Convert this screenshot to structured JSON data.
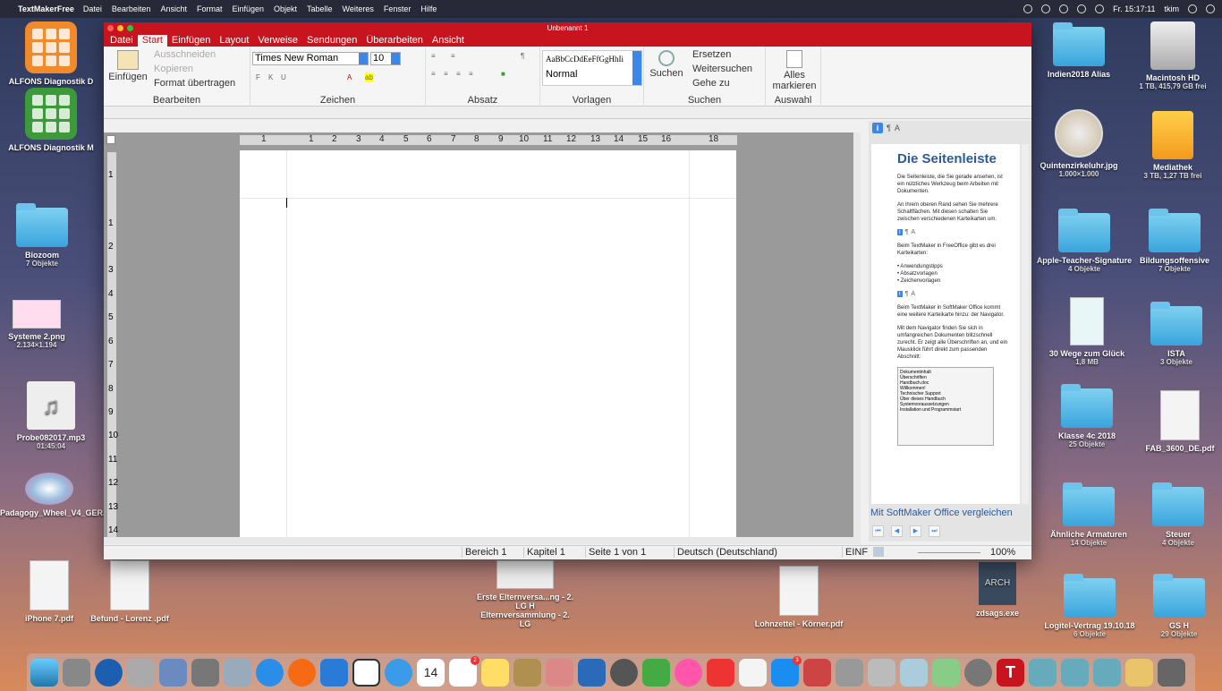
{
  "menubar": {
    "app": "TextMakerFree",
    "items": [
      "Datei",
      "Bearbeiten",
      "Ansicht",
      "Format",
      "Einfügen",
      "Objekt",
      "Tabelle",
      "Weiteres",
      "Fenster",
      "Hilfe"
    ],
    "clock": "Fr. 15:17:11",
    "user": "tkim"
  },
  "desktop": {
    "left": [
      {
        "name": "ALFONS Diagnostik D",
        "sub": ""
      },
      {
        "name": "ALFONS Diagnostik M",
        "sub": ""
      },
      {
        "name": "Biozoom",
        "sub": "7 Objekte"
      },
      {
        "name": "Systeme 2.png",
        "sub": "2.134×1.194"
      },
      {
        "name": "Probe082017.mp3",
        "sub": "01:45:04"
      },
      {
        "name": "Padagogy_Wheel_V4_GER.pdf",
        "sub": ""
      },
      {
        "name": "iPhone 7.pdf",
        "sub": ""
      },
      {
        "name": "Befund - Lorenz .pdf",
        "sub": ""
      }
    ],
    "right": [
      {
        "name": "Indien2018 Alias",
        "sub": ""
      },
      {
        "name": "Macintosh HD",
        "sub": "1 TB, 415,79 GB frei"
      },
      {
        "name": "Quintenzirkeluhr.jpg",
        "sub": "1.000×1.000"
      },
      {
        "name": "Mediathek",
        "sub": "3 TB, 1,27 TB frei"
      },
      {
        "name": "Apple-Teacher-Signature",
        "sub": "4 Objekte"
      },
      {
        "name": "Bildungsoffensive",
        "sub": "7 Objekte"
      },
      {
        "name": "30  Wege zum Glück",
        "sub": "1,8 MB"
      },
      {
        "name": "ISTA",
        "sub": "3 Objekte"
      },
      {
        "name": "Klasse 4c 2018",
        "sub": "25 Objekte"
      },
      {
        "name": "FAB_3600_DE.pdf",
        "sub": ""
      },
      {
        "name": "Ähnliche Armaturen",
        "sub": "14 Objekte"
      },
      {
        "name": "Steuer",
        "sub": "4 Objekte"
      },
      {
        "name": "zdsags.exe",
        "sub": ""
      },
      {
        "name": "Logitel-Vertrag 19.10.18",
        "sub": "6 Objekte"
      },
      {
        "name": "GS H",
        "sub": "29 Objekte"
      }
    ],
    "bottom": [
      {
        "name": "Erste Elternversa...ng - 2. LG H",
        "sub": ""
      },
      {
        "name": "Elternversammlung - 2. LG",
        "sub": ""
      },
      {
        "name": "Lohnzettel - Körner.pdf",
        "sub": ""
      }
    ]
  },
  "window": {
    "title": "Unbenannt 1",
    "tabs": [
      "Datei",
      "Start",
      "Einfügen",
      "Layout",
      "Verweise",
      "Sendungen",
      "Überarbeiten",
      "Ansicht"
    ],
    "active_tab": "Start",
    "ribbon": {
      "einfuegen": "Einfügen",
      "ausschneiden": "Ausschneiden",
      "kopieren": "Kopieren",
      "format_uebertragen": "Format übertragen",
      "group_bearbeiten": "Bearbeiten",
      "font_name": "Times New Roman",
      "font_size": "10",
      "group_zeichen": "Zeichen",
      "group_absatz": "Absatz",
      "style_preview": "AaBbCcDdEeFfGgHhIi",
      "style_name": "Normal",
      "group_vorlagen": "Vorlagen",
      "suchen": "Suchen",
      "ersetzen": "Ersetzen",
      "weitersuchen": "Weitersuchen",
      "gehe_zu": "Gehe zu",
      "group_suchen": "Suchen",
      "alles_markieren_1": "Alles",
      "alles_markieren_2": "markieren",
      "group_auswahl": "Auswahl"
    },
    "ruler_h": [
      "1",
      "1",
      "2",
      "3",
      "4",
      "5",
      "6",
      "7",
      "8",
      "9",
      "10",
      "11",
      "12",
      "13",
      "14",
      "15",
      "16",
      "18"
    ],
    "ruler_v": [
      "1",
      "1",
      "2",
      "3",
      "4",
      "5",
      "6",
      "7",
      "8",
      "9",
      "10",
      "11",
      "12",
      "13",
      "14"
    ],
    "sidebar": {
      "title": "Die Seitenleiste",
      "p1": "Die Seitenleiste, die Sie gerade ansehen, ist ein nützliches Werkzeug beim Arbeiten mit Dokumenten.",
      "p2": "An ihrem oberen Rand sehen Sie mehrere Schaltflächen. Mit diesen schalten Sie zwischen verschiedenen Karteikarten um.",
      "p3": "Beim TextMaker in FreeOffice gibt es drei Karteikarten:",
      "bullets": [
        "• Anwendungstipps",
        "• Absatzvorlagen",
        "• Zeichenvorlagen"
      ],
      "p4": "Beim TextMaker in SoftMaker Office kommt eine weitere Karteikarte hinzu: der Navigator.",
      "p5": "Mit dem Navigator finden Sie sich in umfangreichen Dokumenten blitzschnell zurecht. Er zeigt alle Überschriften an, und ein Mausklick führt direkt zum passenden Abschnitt:",
      "shot_lines": [
        "Dokumentinhalt",
        "Überschriften",
        "Handbuch.doc",
        "Willkommen!",
        "Technischer Support",
        "Über dieses Handbuch",
        "Systemvoraussetzungen",
        "Installation und Programmstart"
      ],
      "link": "Mit SoftMaker Office vergleichen"
    },
    "status": {
      "bereich": "Bereich 1",
      "kapitel": "Kapitel 1",
      "seite": "Seite 1 von 1",
      "sprache": "Deutsch (Deutschland)",
      "modus": "EINF",
      "zoom": "100%"
    }
  },
  "dock": {
    "badges": [
      "2",
      "3"
    ],
    "calendar_day": "14"
  },
  "colors": {
    "accent_red": "#c8141e",
    "link_blue": "#2b5a9a",
    "folder_blue": "#39a5dd"
  }
}
